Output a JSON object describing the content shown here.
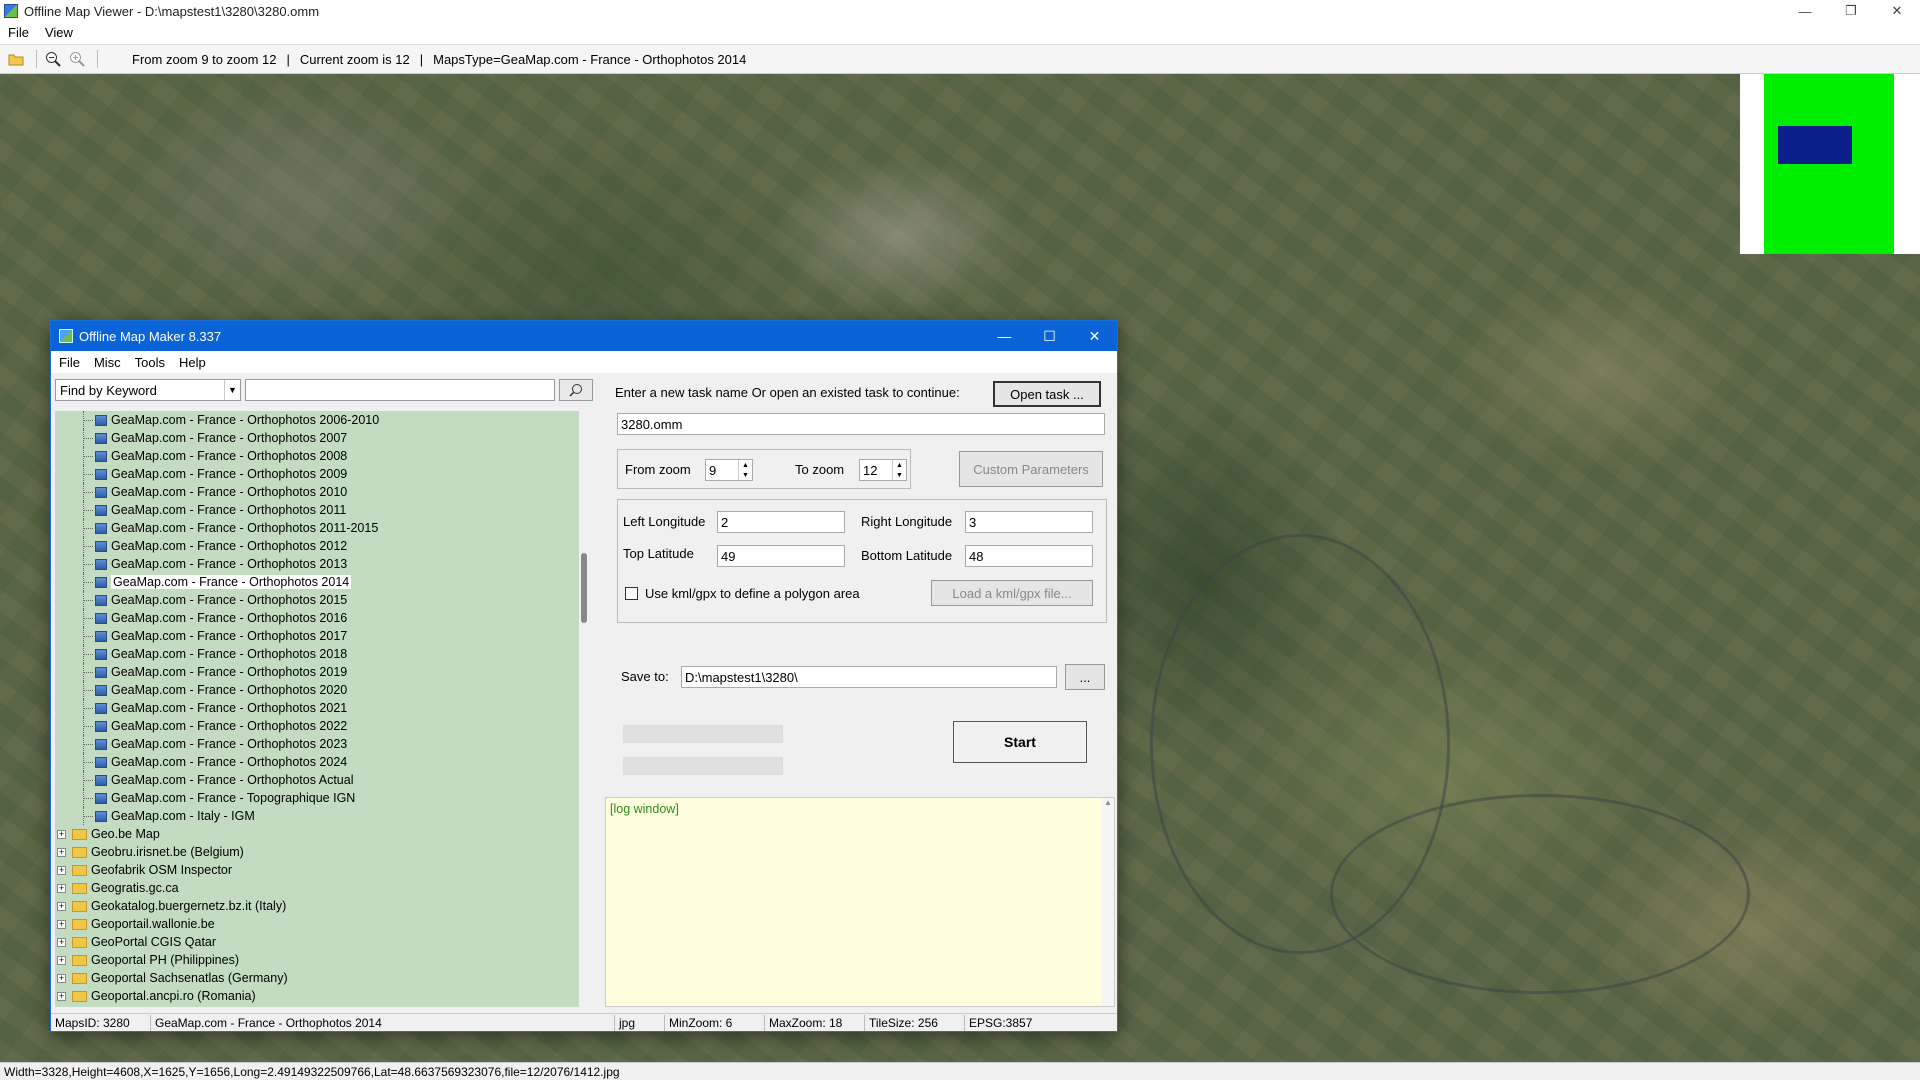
{
  "viewer": {
    "title": "Offline Map Viewer - D:\\mapstest1\\3280\\3280.omm",
    "menu": [
      "File",
      "View"
    ],
    "toolbar": {
      "zoom_range": "From zoom 9 to zoom 12",
      "current_zoom": "Current zoom is 12",
      "maps_type": "MapsType=GeaMap.com - France - Orthophotos 2014",
      "sep1": "|",
      "sep2": "|"
    },
    "status": "Width=3328,Height=4608,X=1625,Y=1656,Long=2.49149322509766,Lat=48.6637569323076,file=12/2076/1412.jpg"
  },
  "maker": {
    "title": "Offline Map Maker 8.337",
    "menu": [
      "File",
      "Misc",
      "Tools",
      "Help"
    ],
    "search": {
      "mode": "Find by Keyword",
      "query": ""
    },
    "tree": {
      "children": [
        "GeaMap.com - France - Orthophotos 2006-2010",
        "GeaMap.com - France - Orthophotos 2007",
        "GeaMap.com - France - Orthophotos 2008",
        "GeaMap.com - France - Orthophotos 2009",
        "GeaMap.com - France - Orthophotos 2010",
        "GeaMap.com - France - Orthophotos 2011",
        "GeaMap.com - France - Orthophotos 2011-2015",
        "GeaMap.com - France - Orthophotos 2012",
        "GeaMap.com - France - Orthophotos 2013",
        "GeaMap.com - France - Orthophotos 2014",
        "GeaMap.com - France - Orthophotos 2015",
        "GeaMap.com - France - Orthophotos 2016",
        "GeaMap.com - France - Orthophotos 2017",
        "GeaMap.com - France - Orthophotos 2018",
        "GeaMap.com - France - Orthophotos 2019",
        "GeaMap.com - France - Orthophotos 2020",
        "GeaMap.com - France - Orthophotos 2021",
        "GeaMap.com - France - Orthophotos 2022",
        "GeaMap.com - France - Orthophotos 2023",
        "GeaMap.com - France - Orthophotos 2024",
        "GeaMap.com - France - Orthophotos Actual",
        "GeaMap.com - France - Topographique IGN",
        "GeaMap.com - Italy - IGM"
      ],
      "selected_index": 9,
      "folders": [
        "Geo.be Map",
        "Geobru.irisnet.be (Belgium)",
        "Geofabrik OSM Inspector",
        "Geogratis.gc.ca",
        "Geokatalog.buergernetz.bz.it (Italy)",
        "Geoportail.wallonie.be",
        "GeoPortal CGIS Qatar",
        "Geoportal PH (Philippines)",
        "Geoportal Sachsenatlas (Germany)",
        "Geoportal.ancpi.ro (Romania)"
      ]
    },
    "task": {
      "prompt": "Enter a new task name Or open an existed task to continue:",
      "open_task": "Open task ...",
      "name": "3280.omm"
    },
    "zoom": {
      "from_label": "From zoom",
      "from_value": "9",
      "to_label": "To zoom",
      "to_value": "12",
      "custom_params": "Custom Parameters"
    },
    "bounds": {
      "left_lon_label": "Left Longitude",
      "left_lon": "2",
      "right_lon_label": "Right Longitude",
      "right_lon": "3",
      "top_lat_label": "Top Latitude",
      "top_lat": "49",
      "bottom_lat_label": "Bottom Latitude",
      "bottom_lat": "48",
      "kml_label": "Use kml/gpx to define a polygon area",
      "load_kml": "Load a kml/gpx file..."
    },
    "save": {
      "label": "Save to:",
      "path": "D:\\mapstest1\\3280\\",
      "browse": "..."
    },
    "start": "Start",
    "log": "[log window]",
    "status": {
      "maps_id": "MapsID: 3280",
      "map_name": "GeaMap.com - France - Orthophotos 2014",
      "format": "jpg",
      "min_zoom": "MinZoom: 6",
      "max_zoom": "MaxZoom: 18",
      "tile_size": "TileSize: 256",
      "epsg": "EPSG:3857"
    }
  },
  "colors": {
    "tree_bg": "#c3dcc1",
    "dialog_titlebar": "#0a64d8",
    "log_bg": "#ffffe0",
    "minimap_green": "#00ee00",
    "minimap_rect": "#0a1f8a"
  }
}
